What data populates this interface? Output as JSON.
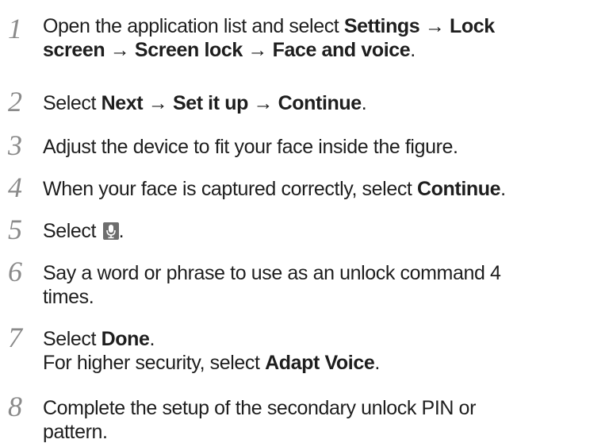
{
  "steps": [
    {
      "number": "1",
      "lines": [
        [
          {
            "t": "Open the application list and select "
          },
          {
            "t": "Settings",
            "b": true
          },
          {
            "t": " → "
          },
          {
            "t": "Lock",
            "b": true
          }
        ],
        [
          {
            "t": "screen",
            "b": true
          },
          {
            "t": " → "
          },
          {
            "t": "Screen lock",
            "b": true
          },
          {
            "t": " → "
          },
          {
            "t": "Face and voice",
            "b": true
          },
          {
            "t": "."
          }
        ]
      ]
    },
    {
      "number": "2",
      "lines": [
        [
          {
            "t": "Select "
          },
          {
            "t": "Next",
            "b": true
          },
          {
            "t": " → "
          },
          {
            "t": "Set it up",
            "b": true
          },
          {
            "t": " → "
          },
          {
            "t": "Continue",
            "b": true
          },
          {
            "t": "."
          }
        ]
      ]
    },
    {
      "number": "3",
      "lines": [
        [
          {
            "t": "Adjust the device to fit your face inside the figure."
          }
        ]
      ]
    },
    {
      "number": "4",
      "lines": [
        [
          {
            "t": "When your face is captured correctly, select "
          },
          {
            "t": "Continue",
            "b": true
          },
          {
            "t": "."
          }
        ]
      ]
    },
    {
      "number": "5",
      "lines": [
        [
          {
            "t": "Select "
          },
          {
            "icon": "microphone-icon"
          },
          {
            "t": "."
          }
        ]
      ]
    },
    {
      "number": "6",
      "lines": [
        [
          {
            "t": "Say a word or phrase to use as an unlock command 4"
          }
        ],
        [
          {
            "t": "times."
          }
        ]
      ]
    },
    {
      "number": "7",
      "lines": [
        [
          {
            "t": "Select "
          },
          {
            "t": "Done",
            "b": true
          },
          {
            "t": "."
          }
        ],
        [
          {
            "t": "For higher security, select "
          },
          {
            "t": "Adapt Voice",
            "b": true
          },
          {
            "t": "."
          }
        ]
      ]
    },
    {
      "number": "8",
      "lines": [
        [
          {
            "t": "Complete the setup of the secondary unlock PIN or"
          }
        ],
        [
          {
            "t": "pattern."
          }
        ]
      ]
    }
  ]
}
